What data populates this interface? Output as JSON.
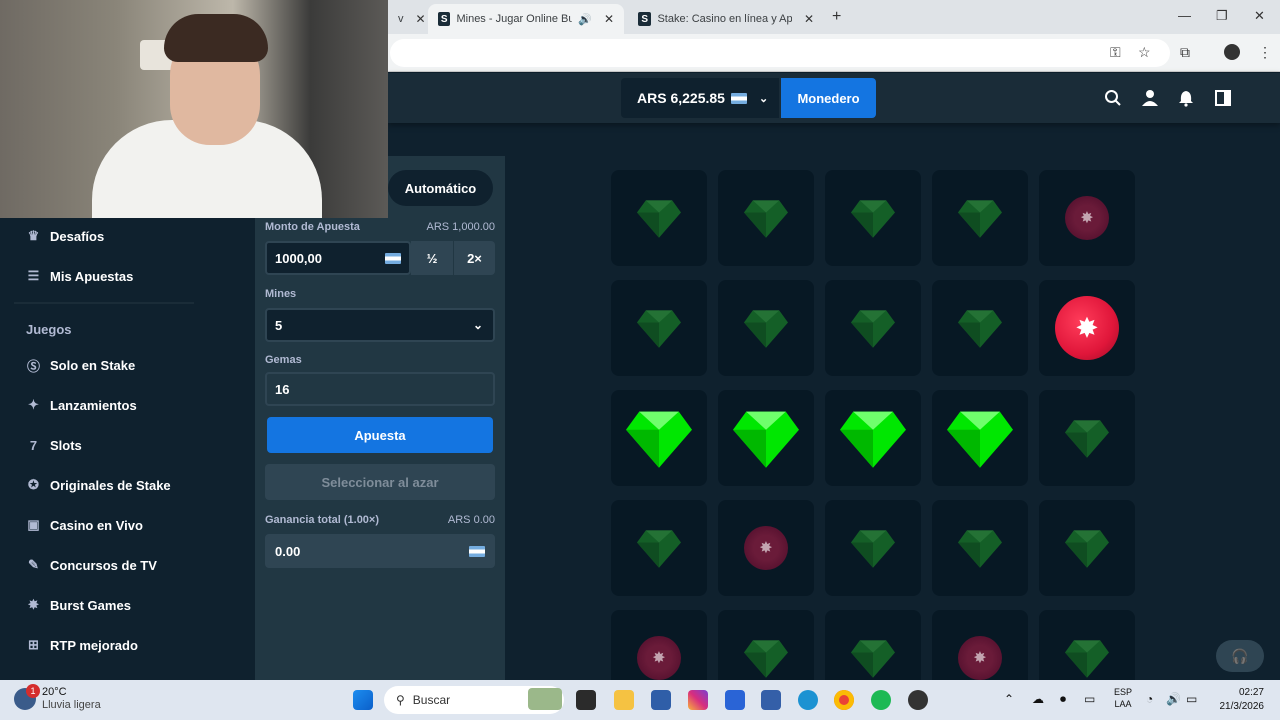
{
  "browser": {
    "tabs": [
      {
        "label": "Mines - Jugar Online Busca",
        "active": true
      },
      {
        "label": "Stake: Casino en línea y Apuest",
        "active": false
      }
    ],
    "partial_tab": "v"
  },
  "header": {
    "balance": "ARS 6,225.85",
    "wallet_label": "Monedero"
  },
  "sidebar": {
    "items_top": [
      {
        "label": "Desafíos",
        "icon": "trophy-icon"
      },
      {
        "label": "Mis Apuestas",
        "icon": "list-icon"
      }
    ],
    "section_title": "Juegos",
    "items": [
      {
        "label": "Solo en Stake",
        "icon": "stake-icon"
      },
      {
        "label": "Lanzamientos",
        "icon": "sparkle-icon"
      },
      {
        "label": "Slots",
        "icon": "slots-icon"
      },
      {
        "label": "Originales de Stake",
        "icon": "star-icon"
      },
      {
        "label": "Casino en Vivo",
        "icon": "live-icon"
      },
      {
        "label": "Concursos de TV",
        "icon": "mic-icon"
      },
      {
        "label": "Burst Games",
        "icon": "burst-icon"
      },
      {
        "label": "RTP mejorado",
        "icon": "rtp-icon"
      }
    ]
  },
  "controls": {
    "mode_tab": "Automático",
    "bet_label": "Monto de Apuesta",
    "bet_value_display": "ARS 1,000.00",
    "bet_input": "1000,00",
    "half_label": "½",
    "double_label": "2×",
    "mines_label": "Mines",
    "mines_value": "5",
    "gems_label": "Gemas",
    "gems_value": "16",
    "bet_button": "Apuesta",
    "random_button": "Seleccionar al azar",
    "profit_label": "Ganancia total (1.00×)",
    "profit_display": "ARS 0.00",
    "profit_input": "0.00"
  },
  "board": {
    "rows": [
      [
        "gem-dim",
        "gem-dim",
        "gem-dim",
        "gem-dim",
        "mine-dim"
      ],
      [
        "gem-dim",
        "gem-dim",
        "gem-dim",
        "gem-dim",
        "mine-big"
      ],
      [
        "gem-big",
        "gem-big",
        "gem-big",
        "gem-big",
        "gem-dim"
      ],
      [
        "gem-dim",
        "mine-dim",
        "gem-dim",
        "gem-dim",
        "gem-dim"
      ],
      [
        "mine-dim",
        "gem-dim",
        "gem-dim",
        "mine-dim",
        "gem-dim"
      ]
    ]
  },
  "taskbar": {
    "weather_temp": "20°C",
    "weather_desc": "Lluvia ligera",
    "weather_badge": "1",
    "search_label": "Buscar",
    "lang_1": "ESP",
    "lang_2": "LAA",
    "time": "02:27",
    "date": "21/3/2026"
  },
  "colors": {
    "bg": "#0f212e",
    "panel": "#213743",
    "accent_blue": "#1475e1",
    "gem_green": "#00e701",
    "mine_red": "#e0163a"
  }
}
